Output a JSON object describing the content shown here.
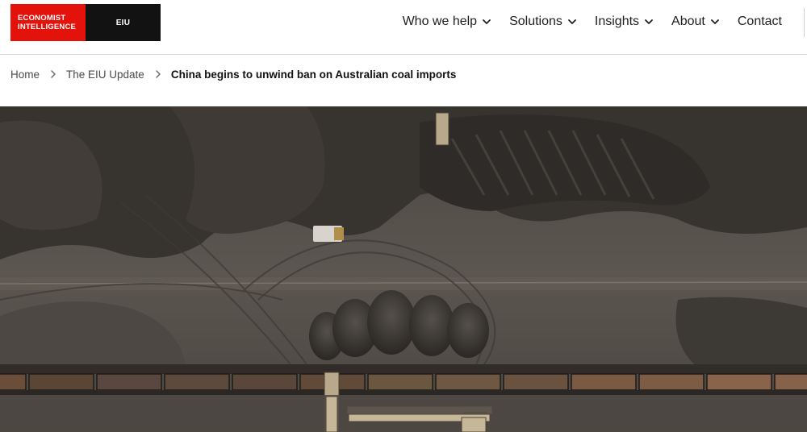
{
  "logo": {
    "line1": "ECONOMIST",
    "line2": "INTELLIGENCE",
    "short": "EIU"
  },
  "nav": {
    "items": [
      {
        "label": "Who we help",
        "has_dropdown": true
      },
      {
        "label": "Solutions",
        "has_dropdown": true
      },
      {
        "label": "Insights",
        "has_dropdown": true
      },
      {
        "label": "About",
        "has_dropdown": true
      },
      {
        "label": "Contact",
        "has_dropdown": false
      }
    ]
  },
  "breadcrumb": {
    "home": "Home",
    "section": "The EIU Update",
    "current": "China begins to unwind ban on Australian coal imports",
    "separator_icon": "chevron-right-icon"
  },
  "hero": {
    "description_icon": "aerial-coal-yard-photo"
  },
  "colors": {
    "brand_red": "#e3120b",
    "brand_black": "#121212"
  }
}
